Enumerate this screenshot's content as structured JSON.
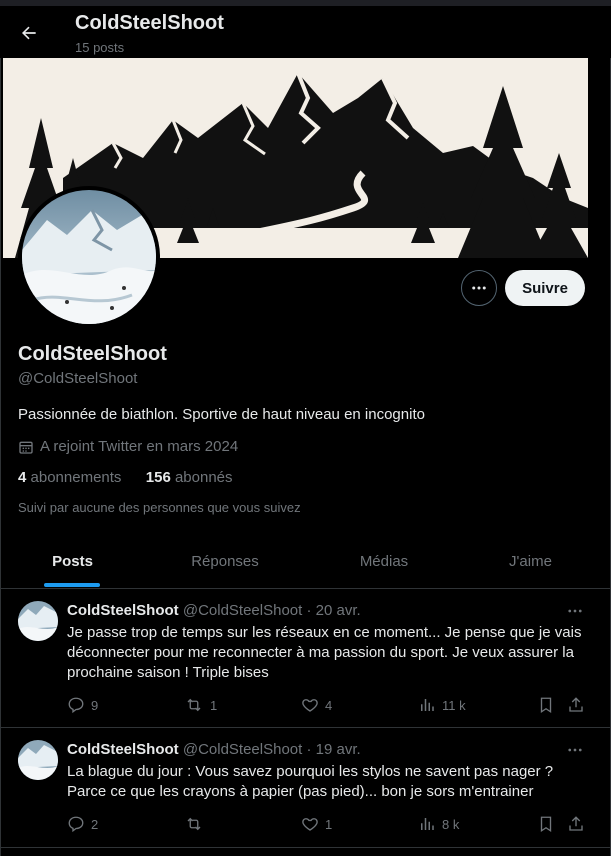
{
  "header": {
    "back_icon": "arrow-left-icon",
    "title": "ColdSteelShoot",
    "posts_count": "15 posts"
  },
  "profile": {
    "follow_label": "Suivre",
    "more_icon": "more-horizontal-icon",
    "display_name": "ColdSteelShoot",
    "handle": "@ColdSteelShoot",
    "bio": "Passionnée de biathlon. Sportive de haut niveau en incognito",
    "joined_icon": "calendar-icon",
    "joined": "A rejoint Twitter en mars 2024",
    "following_count": "4",
    "following_label": "abonnements",
    "followers_count": "156",
    "followers_label": "abonnés",
    "followed_by": "Suivi par aucune des personnes que vous suivez"
  },
  "tabs": [
    {
      "label": "Posts",
      "active": true
    },
    {
      "label": "Réponses",
      "active": false
    },
    {
      "label": "Médias",
      "active": false
    },
    {
      "label": "J'aime",
      "active": false
    }
  ],
  "tweets": [
    {
      "name": "ColdSteelShoot",
      "handle": "@ColdSteelShoot",
      "date": "· 20 avr.",
      "text": "Je passe trop de temps sur les réseaux en ce moment...  Je pense que je vais déconnecter pour me reconnecter à ma passion du sport. Je veux assurer la prochaine saison ! Triple bises",
      "replies": "9",
      "retweets": "1",
      "likes": "4",
      "views": "11 k"
    },
    {
      "name": "ColdSteelShoot",
      "handle": "@ColdSteelShoot",
      "date": "· 19 avr.",
      "text": "La blague du jour : Vous savez pourquoi les stylos ne savent pas nager ? Parce ce que les crayons à papier (pas pied)... bon je sors m'entrainer",
      "replies": "2",
      "retweets": "",
      "likes": "1",
      "views": "8 k"
    }
  ],
  "colors": {
    "accent": "#1d9bf0",
    "background": "#000000",
    "muted_text": "#71767b",
    "banner_bg": "#f3eee6"
  }
}
